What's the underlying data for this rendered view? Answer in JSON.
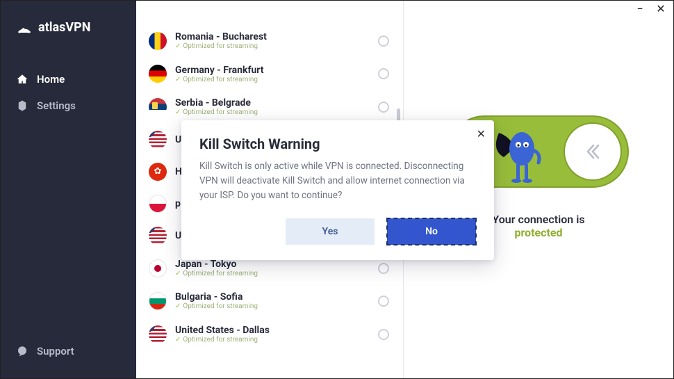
{
  "brand": "atlasVPN",
  "window_controls": {
    "minimize": "−",
    "close": "✕"
  },
  "nav": {
    "home": "Home",
    "settings": "Settings",
    "support": "Support"
  },
  "servers": [
    {
      "name": "Romania - Bucharest",
      "sub": "Optimized for streaming",
      "flag": "flag-ro"
    },
    {
      "name": "Germany - Frankfurt",
      "sub": "Optimized for streaming",
      "flag": "flag-de"
    },
    {
      "name": "Serbia - Belgrade",
      "sub": "Optimized for streaming",
      "flag": "flag-rs"
    },
    {
      "name": "U",
      "sub": "",
      "flag": "flag-us"
    },
    {
      "name": "H",
      "sub": "",
      "flag": "flag-hk"
    },
    {
      "name": "p",
      "sub": "",
      "flag": "flag-pl"
    },
    {
      "name": "U",
      "sub": "",
      "flag": "flag-us"
    },
    {
      "name": "Japan - Tokyo",
      "sub": "Optimized for streaming",
      "flag": "flag-jp"
    },
    {
      "name": "Bulgaria - Sofia",
      "sub": "Optimized for streaming",
      "flag": "flag-bg"
    },
    {
      "name": "United States - Dallas",
      "sub": "Optimized for streaming",
      "flag": "flag-us"
    }
  ],
  "status": {
    "line1": "Your connection is",
    "line2": "protected"
  },
  "modal": {
    "title": "Kill Switch Warning",
    "body": "Kill Switch is only active while VPN is connected. Disconnecting VPN will deactivate Kill Switch and allow internet connection via your ISP. Do you want to continue?",
    "yes": "Yes",
    "no": "No"
  }
}
